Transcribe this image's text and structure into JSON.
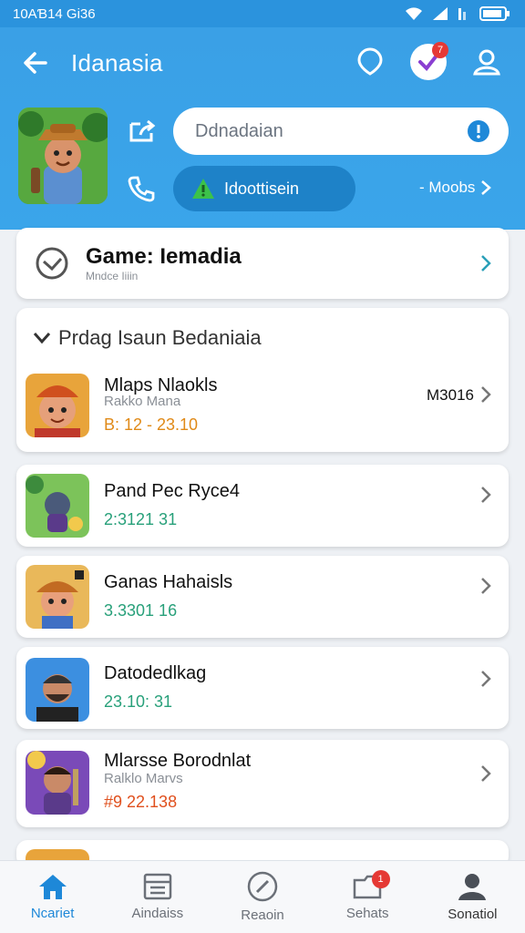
{
  "status_bar": {
    "time": "10AƁ14 Gi36"
  },
  "header": {
    "title": "Idanasia",
    "notification_count": "7",
    "search_placeholder": "Ddnadaian",
    "action_pill_label": "Idoottisein",
    "more_label": "- Moobs"
  },
  "featured": {
    "title": "Game: Iemadia",
    "subtitle": "Mndce Iiiin"
  },
  "section": {
    "heading": "Prdag Isaun Bedaniaia"
  },
  "games": [
    {
      "name": "Mlaps Nlaokls",
      "developer": "Rakko Mana",
      "meta": "B: 12 - 23.10",
      "meta_color": "#e08a18",
      "side": "M3016",
      "thumb": "boy-hat"
    },
    {
      "name": "Pand Pec Ryce4",
      "developer": "",
      "meta": "2:3121 31",
      "meta_color": "#28a07a",
      "side": "",
      "thumb": "knight"
    },
    {
      "name": "Ganas Hahaisls",
      "developer": "",
      "meta": "3.3301 16",
      "meta_color": "#28a07a",
      "side": "",
      "thumb": "miner"
    },
    {
      "name": "Datodedlkag",
      "developer": "",
      "meta": "23.10: 31",
      "meta_color": "#28a07a",
      "side": "",
      "thumb": "man"
    },
    {
      "name": "Mlarsse Borodnlat",
      "developer": "Ralklo Marvs",
      "meta": "#9 22.138",
      "meta_color": "#e0501e",
      "side": "",
      "thumb": "warrior"
    }
  ],
  "nav": [
    {
      "label": "Ncariet",
      "icon": "home-icon",
      "active": true
    },
    {
      "label": "Aindaiss",
      "icon": "list-icon",
      "active": false
    },
    {
      "label": "Reaoin",
      "icon": "compass-icon",
      "active": false
    },
    {
      "label": "Sehats",
      "icon": "folder-icon",
      "active": false,
      "badge": "1"
    },
    {
      "label": "Sonatiol",
      "icon": "profile-icon",
      "active": false
    }
  ],
  "colors": {
    "header": "#3aa0e6",
    "accent": "#1e88d8",
    "badge": "#e53935"
  }
}
